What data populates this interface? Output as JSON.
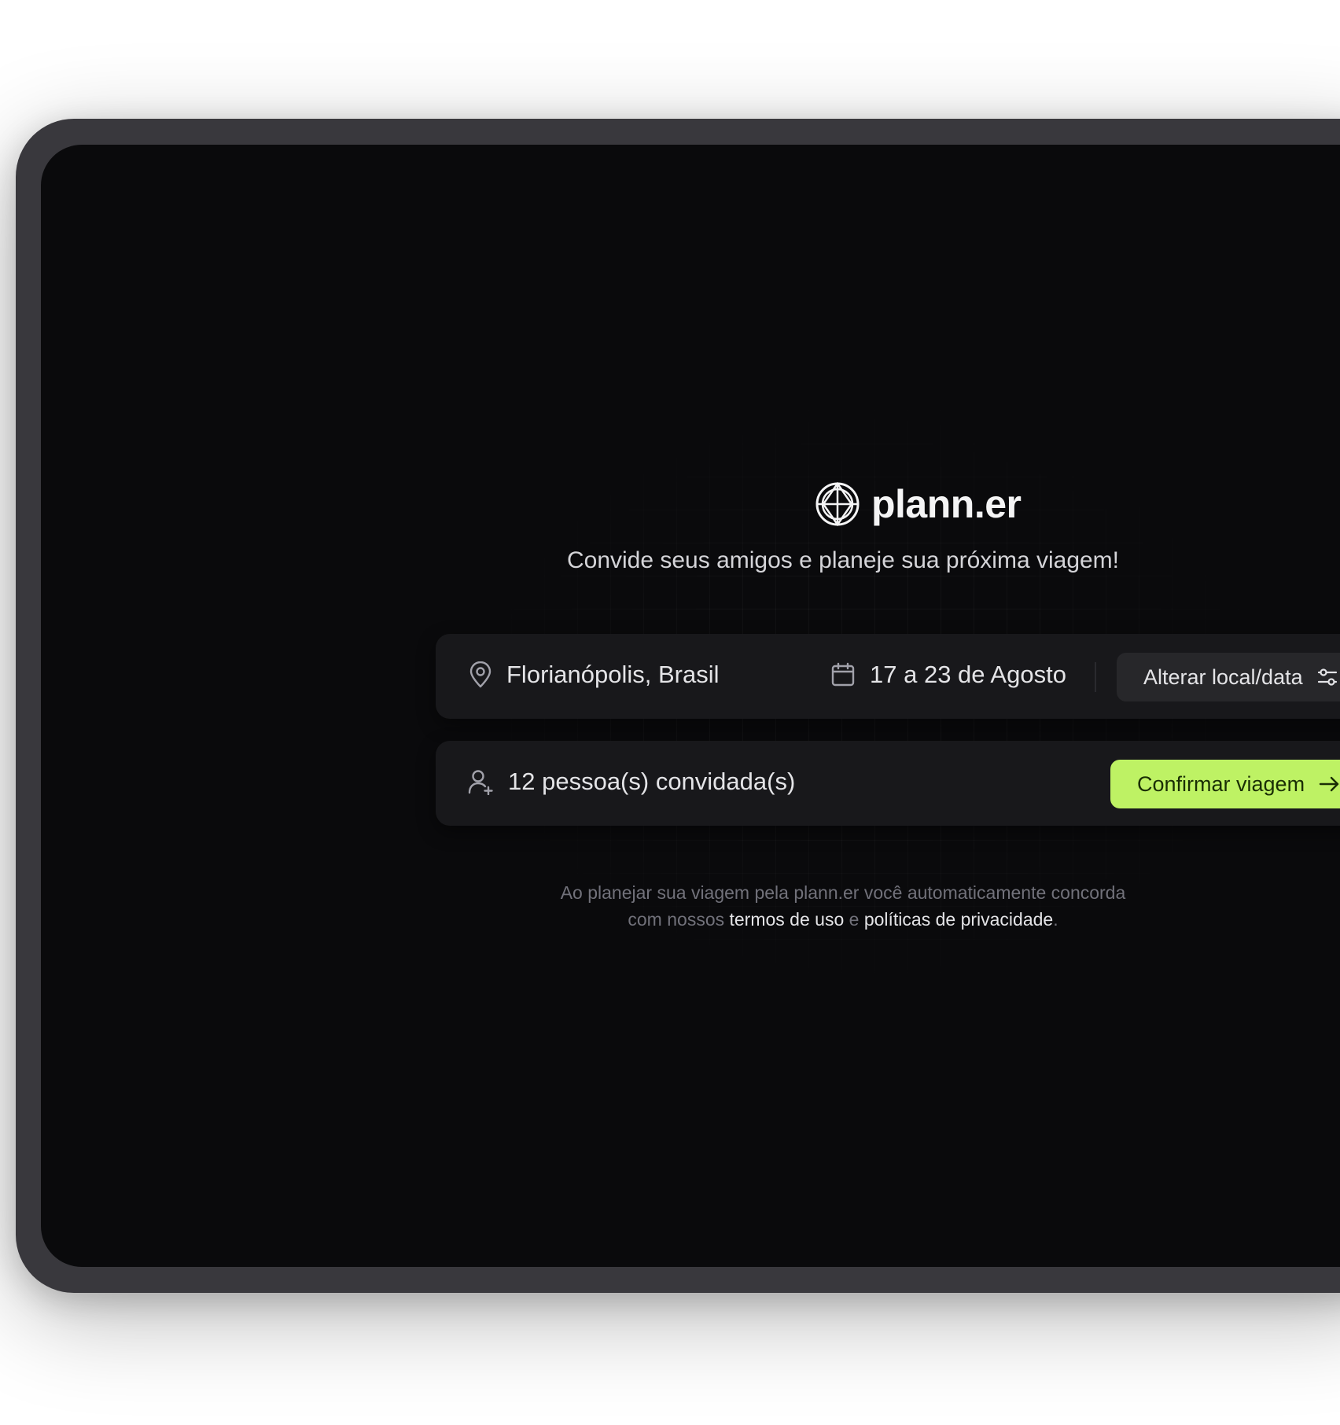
{
  "brand": {
    "name": "plann.er",
    "icon": "globe-logo-icon"
  },
  "tagline": "Convide seus amigos e planeje sua próxima viagem!",
  "trip": {
    "location": "Florianópolis, Brasil",
    "dates": "17 a 23 de Agosto",
    "change_label": "Alterar local/data"
  },
  "guests": {
    "label": "12 pessoa(s) convidada(s)"
  },
  "confirm": {
    "label": "Confirmar viagem"
  },
  "terms": {
    "line1": "Ao planejar sua viagem pela plann.er você automaticamente concorda",
    "prefix": "com nossos",
    "terms_link": "termos de uso",
    "conjunction": "e",
    "privacy_link": "políticas de privacidade",
    "suffix": "."
  },
  "colors": {
    "accent": "#bef264",
    "background": "#0a0a0c",
    "card": "#18181b",
    "device_frame": "#39383d"
  }
}
